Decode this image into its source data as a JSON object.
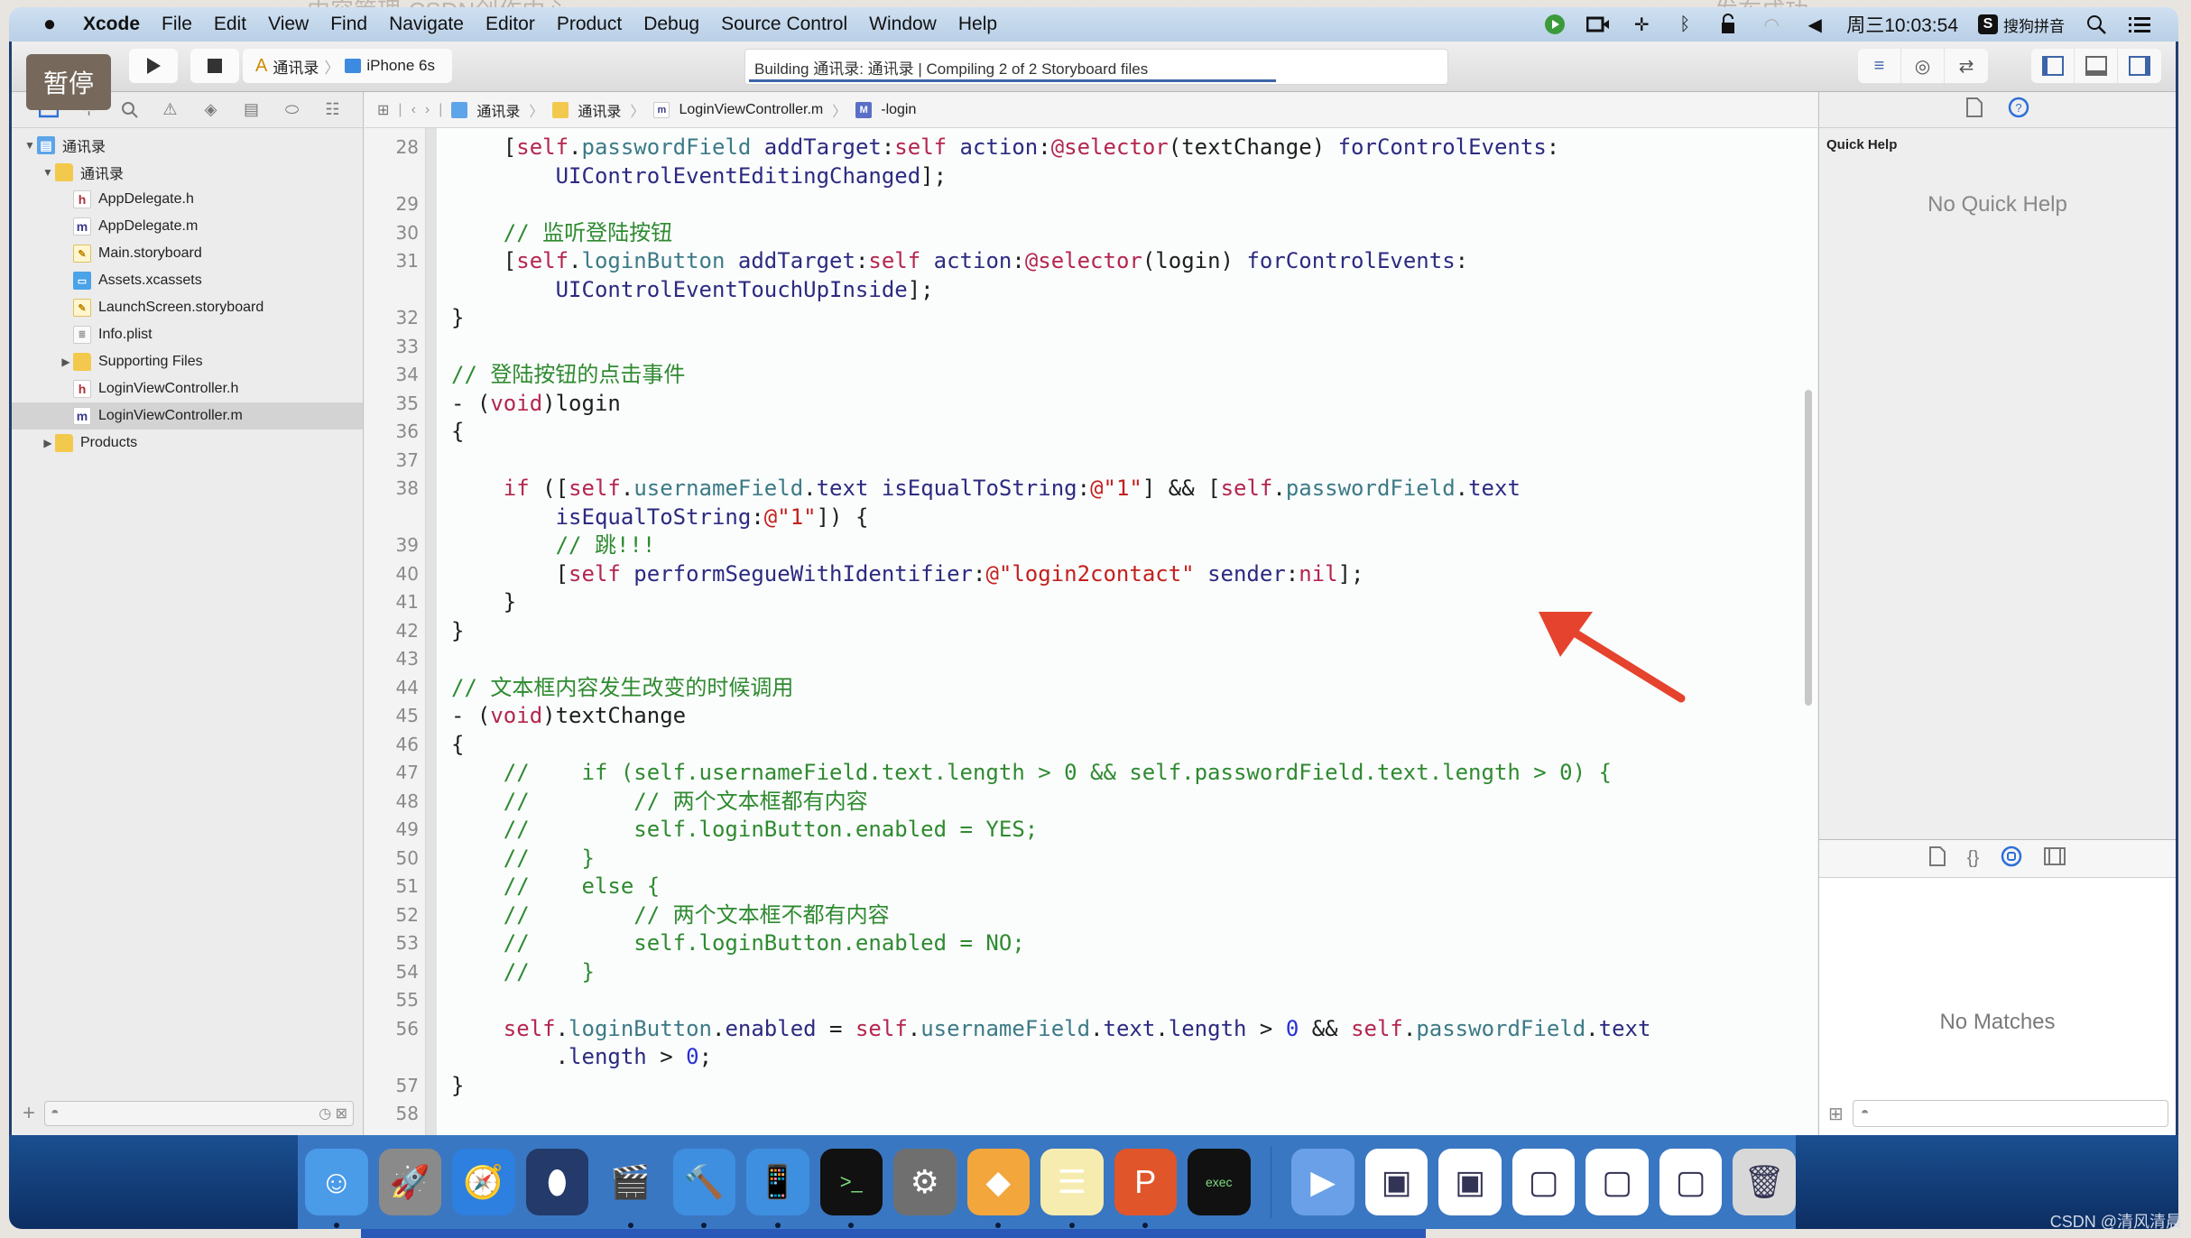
{
  "background": {
    "tab_left": "内容管理-CSDN创作中心",
    "tab_right": "发布成功"
  },
  "menubar": {
    "app": "Xcode",
    "items": [
      "File",
      "Edit",
      "View",
      "Find",
      "Navigate",
      "Editor",
      "Product",
      "Debug",
      "Source Control",
      "Window",
      "Help"
    ],
    "clock": "周三10:03:54",
    "input_method": "搜狗拼音",
    "status_icons": [
      "recorder-icon",
      "camera-icon",
      "pin-icon",
      "bluetooth-icon",
      "lock-icon",
      "wifi-icon",
      "volume-icon"
    ]
  },
  "toolbar": {
    "pause_overlay": "暂停",
    "scheme": "通讯录",
    "device": "iPhone 6s",
    "activity_status": "Building 通讯录: 通讯录  |  Compiling 2 of 2 Storyboard files",
    "build_progress_percent": 75
  },
  "navigator": {
    "tabs": [
      "project-navigator",
      "symbol-navigator",
      "find-navigator",
      "issue-navigator",
      "test-navigator",
      "debug-navigator",
      "breakpoint-navigator",
      "report-navigator"
    ],
    "tree": [
      {
        "label": "通讯录",
        "type": "proj",
        "indent": 0,
        "disclosure": "open"
      },
      {
        "label": "通讯录",
        "type": "folder",
        "indent": 1,
        "disclosure": "open"
      },
      {
        "label": "AppDelegate.h",
        "type": "h",
        "indent": 2,
        "disclosure": ""
      },
      {
        "label": "AppDelegate.m",
        "type": "m",
        "indent": 2,
        "disclosure": ""
      },
      {
        "label": "Main.storyboard",
        "type": "sb",
        "indent": 2,
        "disclosure": ""
      },
      {
        "label": "Assets.xcassets",
        "type": "assets",
        "indent": 2,
        "disclosure": ""
      },
      {
        "label": "LaunchScreen.storyboard",
        "type": "sb",
        "indent": 2,
        "disclosure": ""
      },
      {
        "label": "Info.plist",
        "type": "plist",
        "indent": 2,
        "disclosure": ""
      },
      {
        "label": "Supporting Files",
        "type": "folder",
        "indent": 2,
        "disclosure": "closed"
      },
      {
        "label": "LoginViewController.h",
        "type": "h",
        "indent": 2,
        "disclosure": ""
      },
      {
        "label": "LoginViewController.m",
        "type": "m",
        "indent": 2,
        "disclosure": "",
        "selected": true
      },
      {
        "label": "Products",
        "type": "folder",
        "indent": 1,
        "disclosure": "closed"
      }
    ]
  },
  "jumpbar": {
    "items": [
      "通讯录",
      "通讯录",
      "LoginViewController.m",
      "-login"
    ]
  },
  "editor": {
    "lines": [
      {
        "n": "28",
        "html": "    [<span class=\"kw\">self</span>.<span class=\"prop\">passwordField</span> <span class=\"meth\">addTarget</span>:<span class=\"kw\">self</span> <span class=\"meth\">action</span>:<span class=\"kw\">@selector</span>(textChange) <span class=\"meth\">forControlEvents</span>:"
      },
      {
        "n": "",
        "html": "        <span class=\"meth\">UIControlEventEditingChanged</span>];"
      },
      {
        "n": "29",
        "html": ""
      },
      {
        "n": "30",
        "html": "    <span class=\"cmt\">// 监听登陆按钮</span>"
      },
      {
        "n": "31",
        "html": "    [<span class=\"kw\">self</span>.<span class=\"prop\">loginButton</span> <span class=\"meth\">addTarget</span>:<span class=\"kw\">self</span> <span class=\"meth\">action</span>:<span class=\"kw\">@selector</span>(login) <span class=\"meth\">forControlEvents</span>:"
      },
      {
        "n": "",
        "html": "        <span class=\"meth\">UIControlEventTouchUpInside</span>];"
      },
      {
        "n": "32",
        "html": "}"
      },
      {
        "n": "33",
        "html": ""
      },
      {
        "n": "34",
        "html": "<span class=\"cmt\">// 登陆按钮的点击事件</span>"
      },
      {
        "n": "35",
        "html": "- (<span class=\"kw\">void</span>)login"
      },
      {
        "n": "36",
        "html": "{"
      },
      {
        "n": "37",
        "html": ""
      },
      {
        "n": "38",
        "html": "    <span class=\"kw\">if</span> ([<span class=\"kw\">self</span>.<span class=\"prop\">usernameField</span>.<span class=\"meth\">text</span> <span class=\"meth\">isEqualToString</span>:<span class=\"str\">@\"1\"</span>] &amp;&amp; [<span class=\"kw\">self</span>.<span class=\"prop\">passwordField</span>.<span class=\"meth\">text</span>"
      },
      {
        "n": "",
        "html": "        <span class=\"meth\">isEqualToString</span>:<span class=\"str\">@\"1\"</span>]) {"
      },
      {
        "n": "39",
        "html": "        <span class=\"cmt\">// 跳!!!</span>"
      },
      {
        "n": "40",
        "html": "        [<span class=\"kw\">self</span> <span class=\"meth\">performSegueWithIdentifier</span>:<span class=\"str\">@\"login2contact\"</span> <span class=\"meth\">sender</span>:<span class=\"kw\">nil</span>];"
      },
      {
        "n": "41",
        "html": "    }"
      },
      {
        "n": "42",
        "html": "}"
      },
      {
        "n": "43",
        "html": ""
      },
      {
        "n": "44",
        "html": "<span class=\"cmt\">// 文本框内容发生改变的时候调用</span>"
      },
      {
        "n": "45",
        "html": "- (<span class=\"kw\">void</span>)textChange"
      },
      {
        "n": "46",
        "html": "{"
      },
      {
        "n": "47",
        "html": "    <span class=\"cmt\">//    if (self.usernameField.text.length &gt; 0 &amp;&amp; self.passwordField.text.length &gt; 0) {</span>"
      },
      {
        "n": "48",
        "html": "    <span class=\"cmt\">//        // 两个文本框都有内容</span>"
      },
      {
        "n": "49",
        "html": "    <span class=\"cmt\">//        self.loginButton.enabled = YES;</span>"
      },
      {
        "n": "50",
        "html": "    <span class=\"cmt\">//    }</span>"
      },
      {
        "n": "51",
        "html": "    <span class=\"cmt\">//    else {</span>"
      },
      {
        "n": "52",
        "html": "    <span class=\"cmt\">//        // 两个文本框不都有内容</span>"
      },
      {
        "n": "53",
        "html": "    <span class=\"cmt\">//        self.loginButton.enabled = NO;</span>"
      },
      {
        "n": "54",
        "html": "    <span class=\"cmt\">//    }</span>"
      },
      {
        "n": "55",
        "html": ""
      },
      {
        "n": "56",
        "html": "    <span class=\"kw\">self</span>.<span class=\"prop\">loginButton</span>.<span class=\"meth\">enabled</span> = <span class=\"kw\">self</span>.<span class=\"prop\">usernameField</span>.<span class=\"meth\">text</span>.<span class=\"meth\">length</span> &gt; <span class=\"num\">0</span> &amp;&amp; <span class=\"kw\">self</span>.<span class=\"prop\">passwordField</span>.<span class=\"meth\">text</span>"
      },
      {
        "n": "",
        "html": "        .<span class=\"meth\">length</span> &gt; <span class=\"num\">0</span>;"
      },
      {
        "n": "57",
        "html": "}"
      },
      {
        "n": "58",
        "html": ""
      }
    ]
  },
  "utilities": {
    "quick_help_title": "Quick Help",
    "quick_help_empty": "No Quick Help",
    "library_empty": "No Matches"
  },
  "dock": {
    "apps": [
      {
        "name": "finder",
        "glyph": "☺",
        "bg": "#4a9be8",
        "running": true
      },
      {
        "name": "launchpad",
        "glyph": "🚀",
        "bg": "#8a8a8a",
        "running": false
      },
      {
        "name": "safari",
        "glyph": "🧭",
        "bg": "#2d7fe0",
        "running": false
      },
      {
        "name": "mouse-app",
        "glyph": "⬮",
        "bg": "#233a6a",
        "running": false
      },
      {
        "name": "video-app",
        "glyph": "🎬",
        "bg": "#3a77c2",
        "running": true
      },
      {
        "name": "xcode",
        "glyph": "🔨",
        "bg": "#3f8fe0",
        "running": true
      },
      {
        "name": "simulator",
        "glyph": "📱",
        "bg": "#3f8fe0",
        "running": true
      },
      {
        "name": "terminal",
        "glyph": ">_",
        "bg": "#111111",
        "running": true
      },
      {
        "name": "system-preferences",
        "glyph": "⚙",
        "bg": "#6f6f6f",
        "running": false
      },
      {
        "name": "sketch",
        "glyph": "◆",
        "bg": "#f2a63c",
        "running": true
      },
      {
        "name": "notes",
        "glyph": "☰",
        "bg": "#f7ecb0",
        "running": true
      },
      {
        "name": "powerpoint-app",
        "glyph": "P",
        "bg": "#e0552a",
        "running": true
      },
      {
        "name": "exec-terminal",
        "glyph": "exec",
        "bg": "#111111",
        "running": false
      }
    ],
    "docs": [
      {
        "name": "media-player",
        "glyph": "▶",
        "bg": "#6aa0e8"
      },
      {
        "name": "window-thumbnail-1",
        "glyph": "▣",
        "bg": "#ffffff"
      },
      {
        "name": "window-thumbnail-2",
        "glyph": "▣",
        "bg": "#ffffff"
      },
      {
        "name": "window-thumbnail-3",
        "glyph": "▢",
        "bg": "#ffffff"
      },
      {
        "name": "window-thumbnail-4",
        "glyph": "▢",
        "bg": "#ffffff"
      },
      {
        "name": "window-thumbnail-5",
        "glyph": "▢",
        "bg": "#ffffff"
      },
      {
        "name": "trash",
        "glyph": "🗑",
        "bg": "#d8d8d8"
      }
    ]
  },
  "watermark": "CSDN @清风清晨",
  "colors": {
    "accent": "#2d6fd8",
    "annotation_arrow": "#e5432d",
    "keyword": "#b4264e",
    "comment": "#2f8a30",
    "string": "#c3201c"
  }
}
